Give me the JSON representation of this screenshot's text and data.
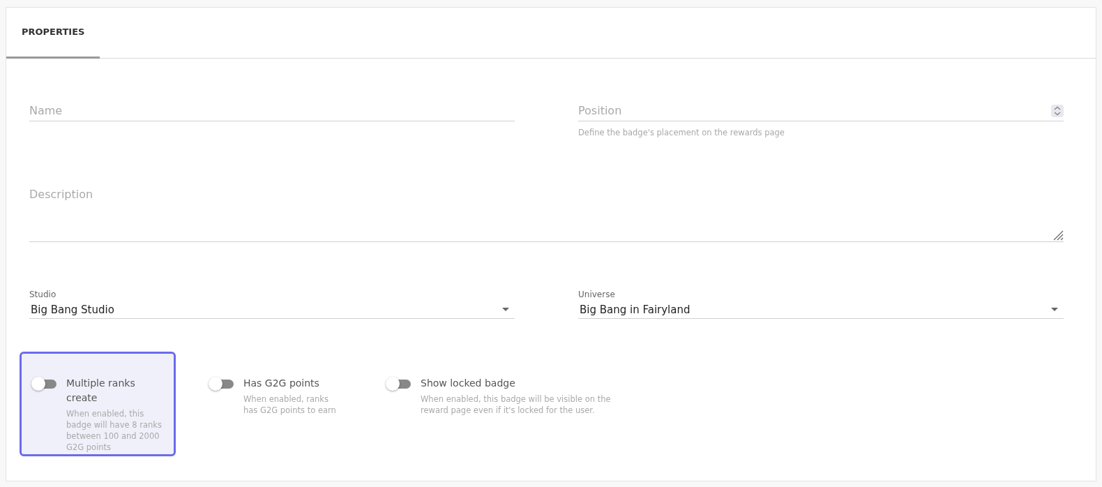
{
  "tabs": [
    {
      "label": "PROPERTIES",
      "selected": true
    }
  ],
  "name_field": {
    "placeholder": "Name"
  },
  "position_field": {
    "placeholder": "Position",
    "helper": "Define the badge's placement on the rewards page"
  },
  "description_field": {
    "placeholder": "Description"
  },
  "selects": [
    {
      "label": "Studio",
      "value": "Big Bang Studio"
    },
    {
      "label": "Universe",
      "value": "Big Bang in Fairyland"
    }
  ],
  "toggles": [
    {
      "label": "Multiple ranks create",
      "description": "When enabled, this badge will have 8 ranks between 100 and 2000 G2G points",
      "on": false,
      "focused": true
    },
    {
      "label": "Has G2G points",
      "description": "When enabled, ranks has G2G points to earn",
      "on": false,
      "focused": false
    },
    {
      "label": "Show locked badge",
      "description": "When enabled, this badge will be visible on the reward page even if it's locked for the user.",
      "on": false,
      "focused": false
    }
  ]
}
